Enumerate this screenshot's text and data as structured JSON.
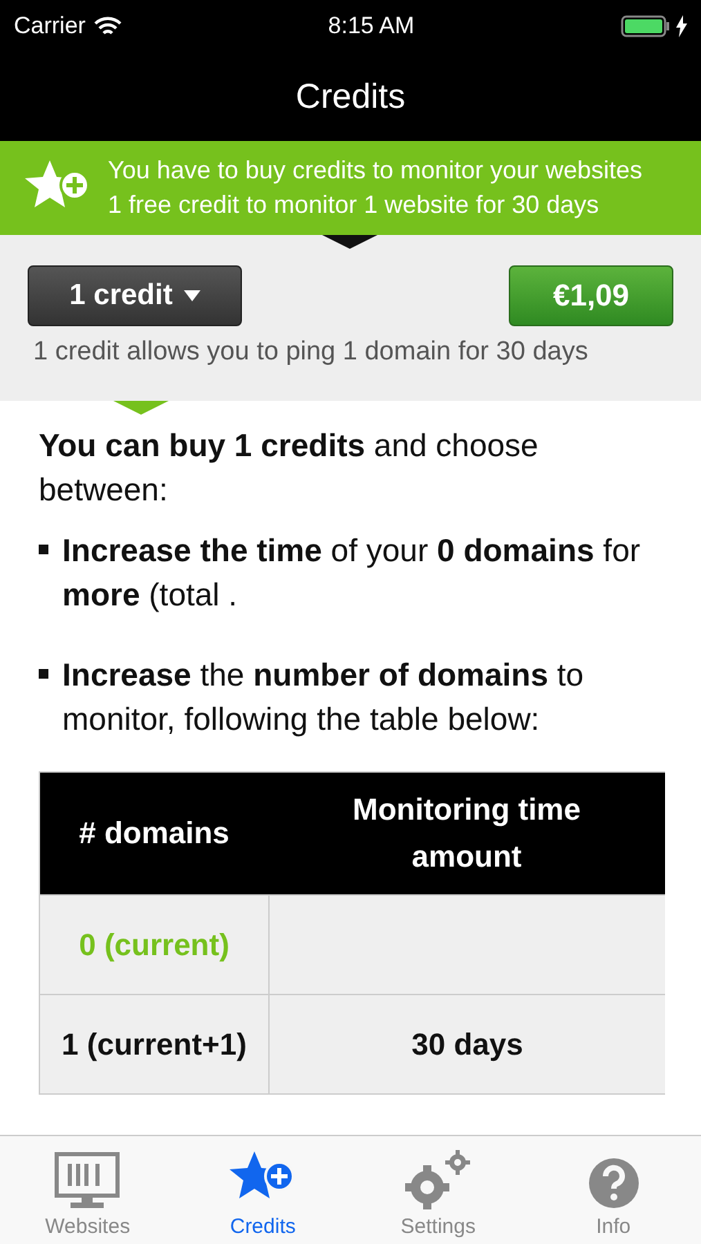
{
  "status_bar": {
    "carrier": "Carrier",
    "time": "8:15 AM"
  },
  "nav": {
    "title": "Credits"
  },
  "banner": {
    "lines": [
      "You have to buy credits to monitor your websites",
      "1 free credit to monitor 1 website for 30 days"
    ]
  },
  "purchase": {
    "selector": "1 credit",
    "price": "€1,09",
    "note": "1 credit allows you to ping 1 domain for 30 days"
  },
  "intro": "**You can buy 1 credits** and choose between:",
  "bullets": [
    "**Increase the time** of your **0 domains** for **more** (total .",
    "**Increase** the **number of domains** to monitor, following the table below:"
  ],
  "table": {
    "columns": [
      "# domains",
      "Monitoring time amount"
    ],
    "rows": [
      {
        "cells": [
          "0 (current)",
          ""
        ],
        "current": true
      },
      {
        "cells": [
          "1 (current+1)",
          "30 days"
        ],
        "current": false
      }
    ]
  },
  "tabs": [
    {
      "label": "Websites",
      "kind": "monitor",
      "selected": false
    },
    {
      "label": "Credits",
      "kind": "star",
      "selected": true
    },
    {
      "label": "Settings",
      "kind": "gears",
      "selected": false
    },
    {
      "label": "Info",
      "kind": "help",
      "selected": false
    }
  ]
}
